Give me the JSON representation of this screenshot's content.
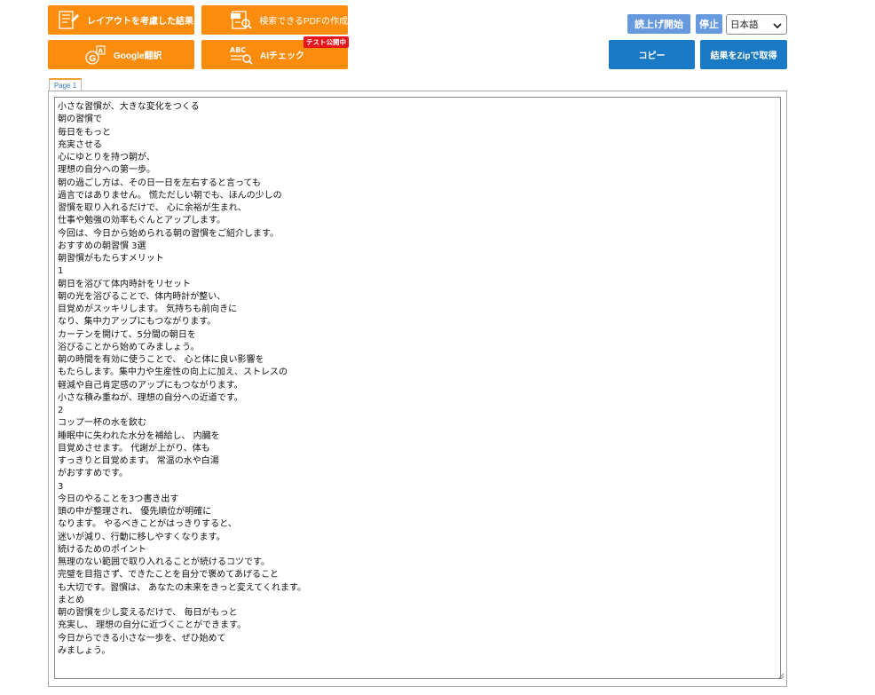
{
  "toolbar": {
    "layout_result_label": "レイアウトを考慮した結果",
    "searchable_pdf_label": "検索できるPDFの作成",
    "google_translate_label": "Google翻訳",
    "ai_check_label": "AIチェック",
    "ai_check_badge": "テスト公開中",
    "read_aloud_label": "読上げ開始",
    "stop_label": "停止",
    "language_selected": "日本語",
    "copy_label": "コピー",
    "zip_label": "結果をZipで取得"
  },
  "icons": {
    "layout": "document-layout-icon",
    "pdf": "pdf-search-icon",
    "google": "translate-icon",
    "ai": "abc-check-icon",
    "caret": "chevron-down-icon",
    "resize": "resize-grip-icon"
  },
  "colors": {
    "orange": "#fc8c0c",
    "blue_light": "#6699dd",
    "blue_dark": "#1a79c4",
    "badge_red": "#e8141c"
  },
  "tabs": [
    "Page 1"
  ],
  "ocr_lines": [
    "小さな習慣が、大きな変化をつくる",
    "朝の習慣で",
    "毎日をもっと",
    "充実させる",
    "心にゆとりを持つ朝が、",
    "理想の自分への第一歩。",
    "朝の過ごし方は、その日一日を左右すると言っても",
    "過言ではありません。 慌ただしい朝でも、ほんの少しの",
    "習慣を取り入れるだけで、 心に余裕が生まれ、",
    "仕事や勉強の効率もぐんとアップします。",
    "今回は、今日から始められる朝の習慣をご紹介します。",
    "おすすめの朝習慣 3選",
    "朝習慣がもたらすメリット",
    "1",
    "朝日を浴びて体内時計をリセット",
    "朝の光を浴びることで、体内時計が整い、",
    "目覚めがスッキリします。 気持ちも前向きに",
    "なり、集中力アップにもつながります。",
    "カーテンを開けて、5分間の朝日を",
    "浴びることから始めてみましょう。",
    "朝の時間を有効に使うことで、 心と体に良い影響を",
    "もたらします。集中力や生産性の向上に加え、ストレスの",
    "軽減や自己肯定感のアップにもつながります。",
    "小さな積み重ねが、理想の自分への近道です。",
    "2",
    "コップ一杯の水を飲む",
    "睡眠中に失われた水分を補給し、 内臓を",
    "目覚めさせます。 代謝が上がり、体も",
    "すっきりと目覚めます。 常温の水や白湯",
    "がおすすめです。",
    "3",
    "今日のやることを3つ書き出す",
    "頭の中が整理され、 優先順位が明確に",
    "なります。 やるべきことがはっきりすると、",
    "迷いが減り、行動に移しやすくなります。",
    "続けるためのポイント",
    "無理のない範囲で取り入れることが続けるコツです。",
    "完璧を目指さず、できたことを自分で褒めてあげること",
    "も大切です。習慣は、 あなたの未来をきっと変えてくれます。",
    "まとめ",
    "朝の習慣を少し変えるだけで、 毎日がもっと",
    "充実し、 理想の自分に近づくことができます。",
    "今日からできる小さな一歩を、ぜひ始めて",
    "みましょう。"
  ]
}
